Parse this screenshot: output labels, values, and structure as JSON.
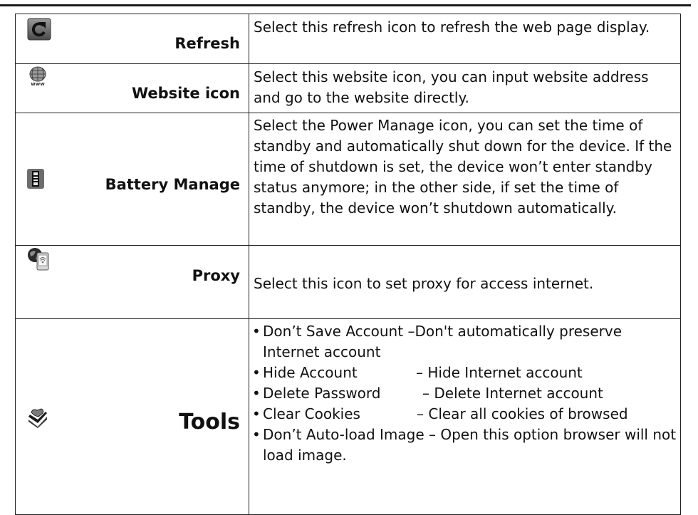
{
  "rows": [
    {
      "icon": "refresh-icon",
      "name": "Refresh",
      "desc": "Select this refresh icon to refresh the web page display."
    },
    {
      "icon": "globe-www-icon",
      "name": "Website icon",
      "desc": "Select this website icon, you can input website address and go to the website directly."
    },
    {
      "icon": "battery-icon",
      "name": "Battery Manage",
      "desc": "Select the Power Manage icon, you can set the time of standby and automatically shut down for the device. If the time of shutdown is set, the device won’t enter standby status anymore; in the other side, if set the time of standby, the device won’t shutdown automatically."
    },
    {
      "icon": "proxy-icon",
      "name": "Proxy",
      "desc": "Select this icon to set proxy for access internet."
    },
    {
      "icon": "tools-icon",
      "name": "Tools",
      "items": [
        {
          "label": "Don’t Save Account",
          "desc": "–Don't automatically preserve Internet account"
        },
        {
          "label": "Hide Account",
          "desc": "– Hide Internet account"
        },
        {
          "label": "Delete Password",
          "desc": "– Delete Internet account"
        },
        {
          "label": "Clear Cookies",
          "desc": "– Clear all cookies of browsed"
        },
        {
          "label": "Don’t Auto-load Image",
          "desc": "– Open this option browser will not load image."
        }
      ]
    }
  ]
}
